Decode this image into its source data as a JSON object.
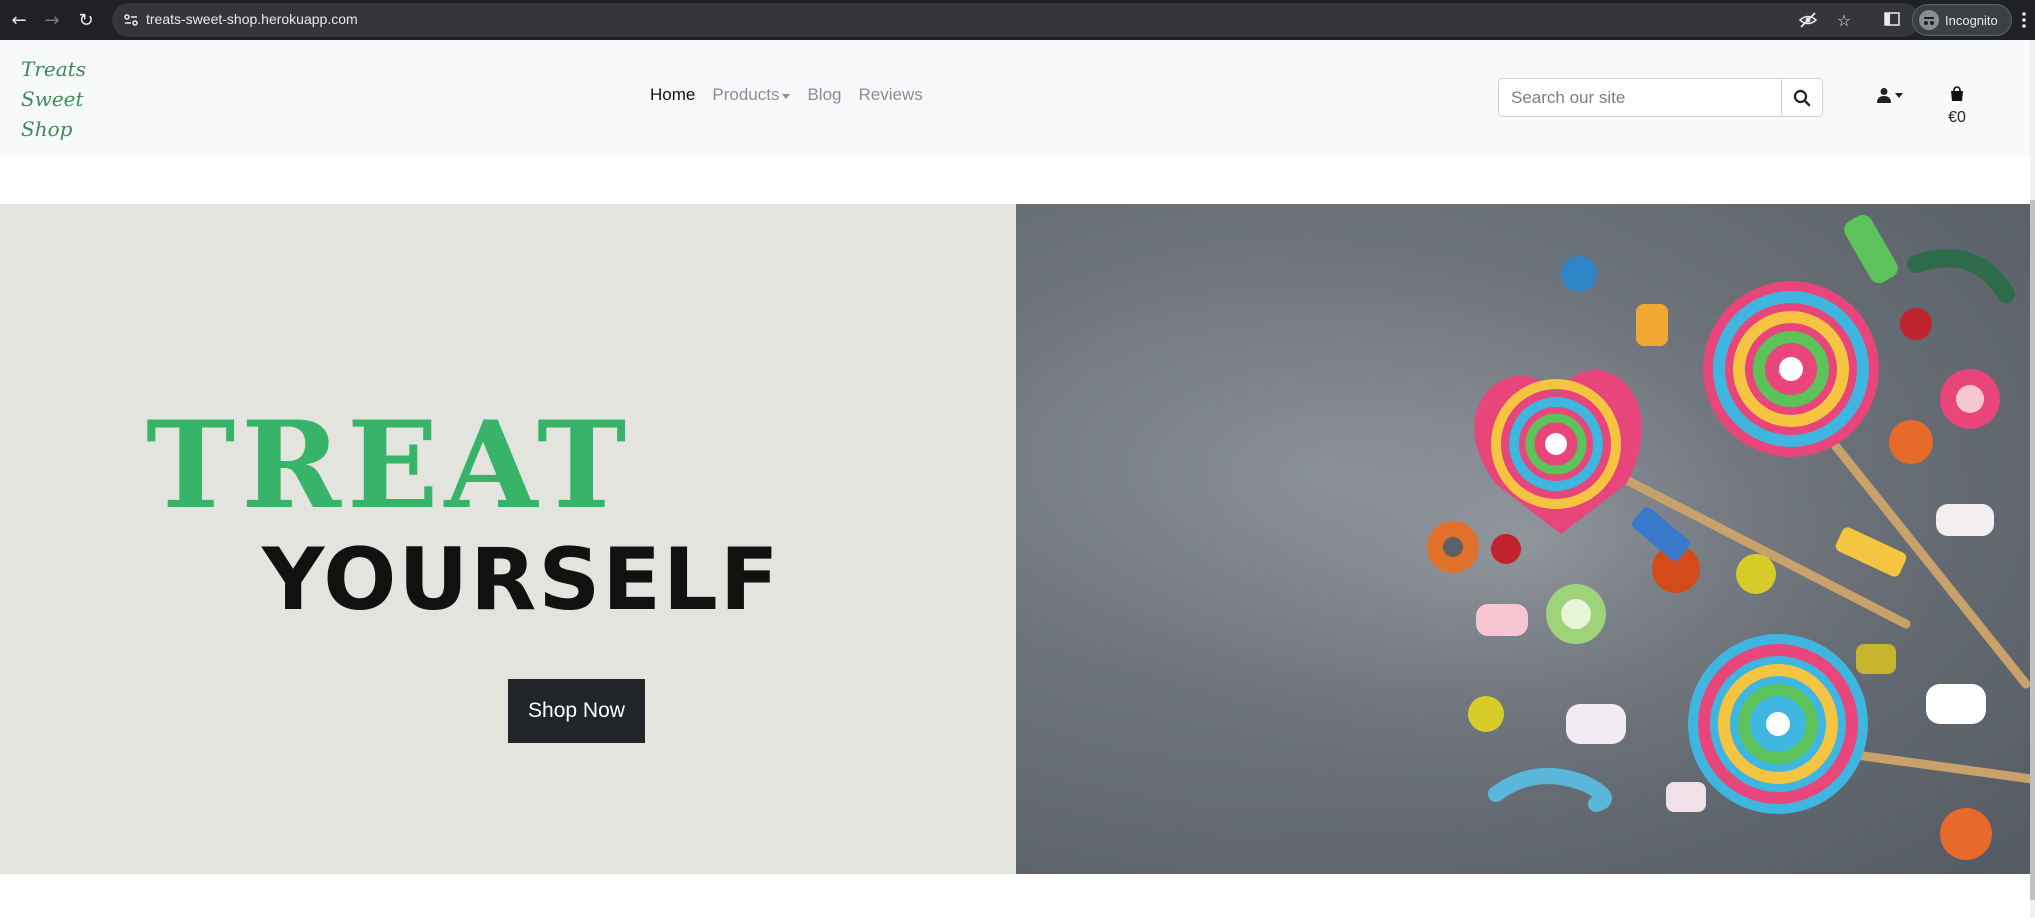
{
  "browser": {
    "url": "treats-sweet-shop.herokuapp.com",
    "profile_label": "Incognito"
  },
  "header": {
    "logo_lines": [
      "Treats",
      "Sweet",
      "Shop"
    ],
    "nav": {
      "home": "Home",
      "products": "Products",
      "blog": "Blog",
      "reviews": "Reviews"
    },
    "search": {
      "placeholder": "Search our site"
    },
    "bag_total": "€0"
  },
  "hero": {
    "title_line_1": "TREAT",
    "title_line_2": "YOURSELF",
    "cta_label": "Shop Now"
  },
  "colors": {
    "brand_green": "#37b46a",
    "logo_green": "#3c8a5c",
    "hero_bg": "#e4e4df",
    "button_dark": "#212529"
  }
}
